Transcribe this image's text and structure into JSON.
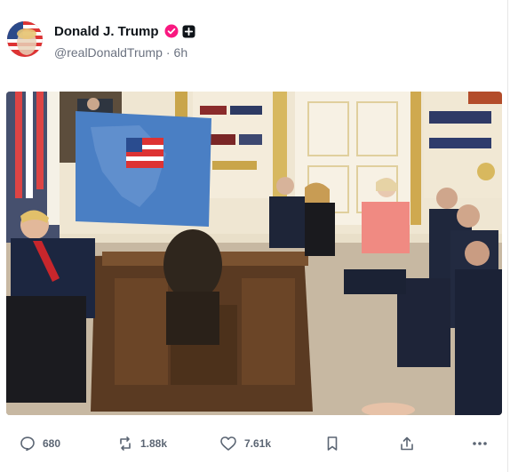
{
  "post": {
    "author": {
      "display_name": "Donald J. Trump",
      "handle": "@realDonaldTrump",
      "separator": "·",
      "time": "6h",
      "avatar_icon": "avatar-flag-portrait",
      "verified_icon": "verified-badge-icon",
      "extra_badge_icon": "plus-badge-icon"
    },
    "media": {
      "type": "photo",
      "map_icon": "north-america-map-with-flag"
    },
    "actions": {
      "replies": "680",
      "reposts": "1.88k",
      "likes": "7.61k",
      "bookmark_icon": "bookmark-icon",
      "share_icon": "share-icon",
      "more_icon": "more-icon"
    },
    "colors": {
      "accent_pink": "#f91880",
      "text_primary": "#0f1419",
      "text_secondary": "#6b7280"
    }
  }
}
